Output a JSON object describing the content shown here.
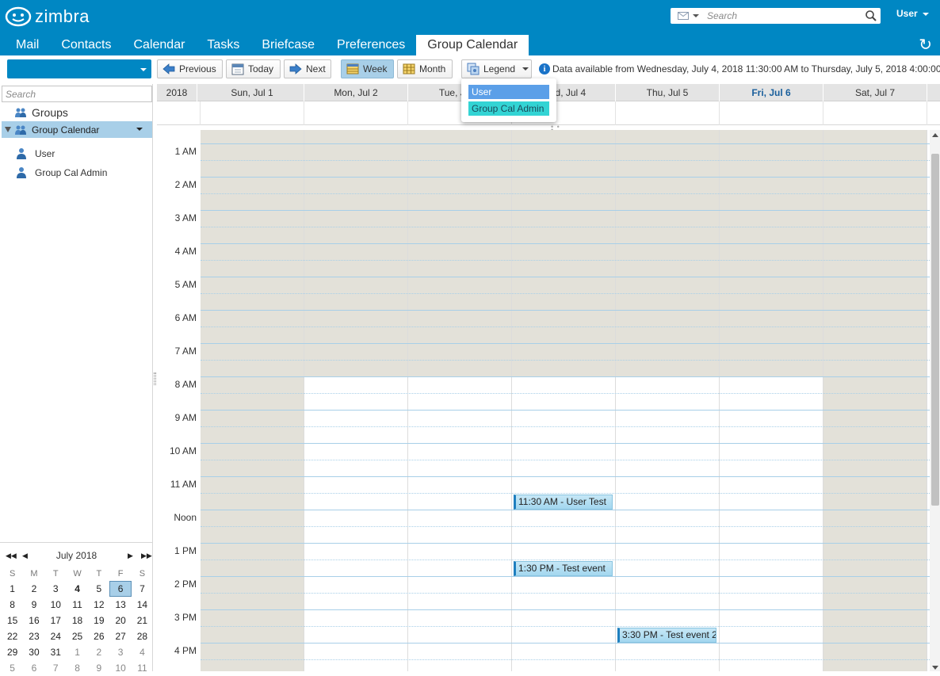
{
  "header": {
    "brand": "zimbra",
    "search_placeholder": "Search",
    "user_label": "User",
    "refresh_icon": "refresh-icon"
  },
  "app_tabs": [
    {
      "label": "Mail",
      "active": false
    },
    {
      "label": "Contacts",
      "active": false
    },
    {
      "label": "Calendar",
      "active": false
    },
    {
      "label": "Tasks",
      "active": false
    },
    {
      "label": "Briefcase",
      "active": false
    },
    {
      "label": "Preferences",
      "active": false
    },
    {
      "label": "Group Calendar",
      "active": true
    }
  ],
  "toolbar": {
    "new_button_label": "",
    "previous_label": "Previous",
    "today_label": "Today",
    "next_label": "Next",
    "week_label": "Week",
    "month_label": "Month",
    "legend_label": "Legend",
    "active_view": "Week",
    "info_text": "Data available from Wednesday, July 4, 2018 11:30:00 AM to Thursday, July 5, 2018 4:00:00"
  },
  "legend": {
    "items": [
      {
        "label": "User",
        "color": "#5b9fe8"
      },
      {
        "label": "Group Cal Admin",
        "color": "#33d4d4"
      }
    ]
  },
  "sidebar": {
    "search_placeholder": "Search",
    "groups_label": "Groups",
    "selected_group": "Group Calendar",
    "members": [
      "User",
      "Group Cal Admin"
    ]
  },
  "mini_calendar": {
    "title": "July 2018",
    "weekdays": [
      "S",
      "M",
      "T",
      "W",
      "T",
      "F",
      "S"
    ],
    "weeks": [
      [
        "1",
        "2",
        "3",
        "4",
        "5",
        "6",
        "7"
      ],
      [
        "8",
        "9",
        "10",
        "11",
        "12",
        "13",
        "14"
      ],
      [
        "15",
        "16",
        "17",
        "18",
        "19",
        "20",
        "21"
      ],
      [
        "22",
        "23",
        "24",
        "25",
        "26",
        "27",
        "28"
      ],
      [
        "29",
        "30",
        "31",
        "1",
        "2",
        "3",
        "4"
      ],
      [
        "5",
        "6",
        "7",
        "8",
        "9",
        "10",
        "11"
      ]
    ],
    "today": "4",
    "selected": "6"
  },
  "calendar": {
    "year_label": "2018",
    "days": [
      {
        "label": "Sun, Jul 1",
        "today": false
      },
      {
        "label": "Mon, Jul 2",
        "today": false
      },
      {
        "label": "Tue, Jul 3",
        "today": false
      },
      {
        "label": "Wed, Jul 4",
        "today": false
      },
      {
        "label": "Thu, Jul 5",
        "today": false
      },
      {
        "label": "Fri, Jul 6",
        "today": true
      },
      {
        "label": "Sat, Jul 7",
        "today": false
      }
    ],
    "hours": [
      "1 AM",
      "2 AM",
      "3 AM",
      "4 AM",
      "5 AM",
      "6 AM",
      "7 AM",
      "8 AM",
      "9 AM",
      "10 AM",
      "11 AM",
      "Noon",
      "1 PM",
      "2 PM",
      "3 PM",
      "4 PM"
    ],
    "working_hours": {
      "start": "8 AM",
      "end": "5 PM",
      "working_days": [
        "Mon",
        "Tue",
        "Wed",
        "Thu",
        "Fri"
      ]
    },
    "colors": {
      "non_working": "#e3e1d9",
      "working": "#ffffff",
      "gridline": "#a8cfe8",
      "event": "#a3d7ef"
    },
    "events": [
      {
        "day": "Wed, Jul 4",
        "title": "11:30 AM - User Test",
        "start_hour": 11.5
      },
      {
        "day": "Wed, Jul 4",
        "title": "1:30 PM - Test event",
        "start_hour": 13.5
      },
      {
        "day": "Thu, Jul 5",
        "title": "3:30 PM - Test event 2",
        "start_hour": 15.5
      }
    ]
  }
}
